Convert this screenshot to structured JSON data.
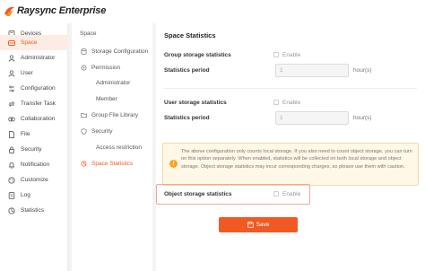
{
  "app": {
    "title": "Raysync Enterprise"
  },
  "colors": {
    "accent": "#f05a22",
    "active_bg": "#fdece3",
    "notice_bg": "#fff8e6"
  },
  "sidebar": {
    "items": [
      {
        "label": "Devices",
        "icon": "devices-icon",
        "active": false
      },
      {
        "label": "Space",
        "icon": "space-icon",
        "active": true
      },
      {
        "label": "Administrator",
        "icon": "administrator-icon",
        "active": false
      },
      {
        "label": "User",
        "icon": "user-icon",
        "active": false
      },
      {
        "label": "Configuration",
        "icon": "configuration-icon",
        "active": false
      },
      {
        "label": "Transfer Task",
        "icon": "transfer-task-icon",
        "active": false
      },
      {
        "label": "Collaboration",
        "icon": "collaboration-icon",
        "active": false
      },
      {
        "label": "File",
        "icon": "file-icon",
        "active": false
      },
      {
        "label": "Security",
        "icon": "security-icon",
        "active": false
      },
      {
        "label": "Notification",
        "icon": "notification-icon",
        "active": false
      },
      {
        "label": "Customize",
        "icon": "customize-icon",
        "active": false
      },
      {
        "label": "Log",
        "icon": "log-icon",
        "active": false
      },
      {
        "label": "Statistics",
        "icon": "statistics-icon",
        "active": false
      }
    ]
  },
  "subnav": {
    "header": "Space",
    "items": [
      {
        "label": "Storage Configuration",
        "icon": "storage-icon",
        "active": false
      },
      {
        "label": "Permission",
        "icon": "permission-icon",
        "active": false
      },
      {
        "label": "Administrator",
        "icon": "",
        "active": false
      },
      {
        "label": "Member",
        "icon": "",
        "active": false
      },
      {
        "label": "Group File Library",
        "icon": "folder-icon",
        "active": false
      },
      {
        "label": "Security",
        "icon": "shield-icon",
        "active": false
      },
      {
        "label": "Access restriction",
        "icon": "",
        "active": false
      },
      {
        "label": "Space Statistics",
        "icon": "statistics-icon",
        "active": true
      }
    ]
  },
  "main": {
    "title": "Space Statistics",
    "group": {
      "label": "Group storage statistics",
      "enable_label": "Enable",
      "enabled": false,
      "period_label": "Statistics period",
      "period_value": "1",
      "unit": "hour(s)"
    },
    "user": {
      "label": "User storage statistics",
      "enable_label": "Enable",
      "enabled": false,
      "period_label": "Statistics period",
      "period_value": "1",
      "unit": "hour(s)"
    },
    "notice": {
      "text": "The above configuration only counts local storage. If you also need to count object storage, you can turn on this option separately. When enabled, statistics will be collected on both local storage and object storage. Object storage statistics may incur corresponding charges, so please use them with caution."
    },
    "object": {
      "label": "Object storage statistics",
      "enable_label": "Enable",
      "enabled": false
    },
    "save_label": "Save"
  }
}
